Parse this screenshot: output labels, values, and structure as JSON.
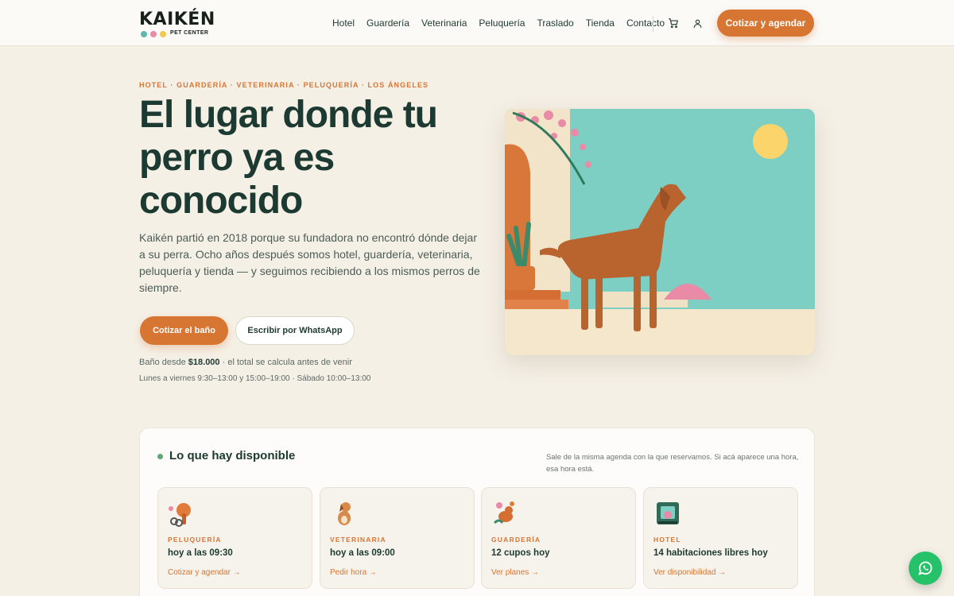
{
  "brand": {
    "name": "KAIKÉN",
    "tagline": "PET CENTER",
    "dot_colors": [
      "#5fb7b0",
      "#e98aa6",
      "#f2c94c"
    ],
    "accent": "#d77533"
  },
  "nav": {
    "items": [
      "Hotel",
      "Guardería",
      "Veterinaria",
      "Peluquería",
      "Traslado",
      "Tienda",
      "Contacto"
    ],
    "cart_icon": "cart-icon",
    "account_icon": "user-icon",
    "cta": "Cotizar y agendar"
  },
  "hero": {
    "eyebrow": "HOTEL · GUARDERÍA · VETERINARIA · PELUQUERÍA · LOS ÁNGELES",
    "title": "El lugar donde tu perro ya es conocido",
    "description": "Kaikén partió en 2018 porque su fundadora no encontró dónde dejar a su perra. Ocho años después somos hotel, guardería, veterinaria, peluquería y tienda — y seguimos recibiendo a los mismos perros de siempre.",
    "primary_button": "Cotizar el baño",
    "secondary_button": "Escribir por WhatsApp",
    "price_prefix": "Baño desde",
    "price_value": "$18.000",
    "price_suffix": "· el total se calcula antes de venir",
    "hours": "Lunes a viernes 9:30–13:00 y 15:00–19:00 · Sábado 10:00–13:00"
  },
  "availability": {
    "title": "Lo que hay disponible",
    "note": "Sale de la misma agenda con la que reservamos. Si acá aparece una hora, esa hora está.",
    "services": [
      {
        "label": "PELUQUERÍA",
        "value": "hoy a las 09:30",
        "link": "Cotizar y agendar →",
        "icon": "grooming-dryer-icon"
      },
      {
        "label": "VETERINARIA",
        "value": "hoy a las 09:00",
        "link": "Pedir hora →",
        "icon": "vet-dog-icon"
      },
      {
        "label": "GUARDERÍA",
        "value": "12 cupos hoy",
        "link": "Ver planes →",
        "icon": "daycare-dog-icon"
      },
      {
        "label": "HOTEL",
        "value": "14 habitaciones libres hoy",
        "link": "Ver disponibilidad →",
        "icon": "hotel-icon"
      }
    ]
  },
  "whatsapp": {
    "icon": "whatsapp-icon",
    "color": "#25c26a"
  }
}
